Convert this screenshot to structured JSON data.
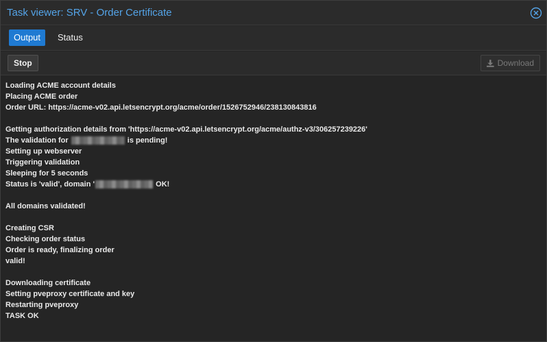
{
  "window": {
    "title": "Task viewer: SRV - Order Certificate",
    "accent_color": "#54a4e8",
    "close_icon": "close-circle-icon"
  },
  "tabs": [
    {
      "label": "Output",
      "active": true
    },
    {
      "label": "Status",
      "active": false
    }
  ],
  "toolbar": {
    "stop_label": "Stop",
    "download_label": "Download",
    "download_enabled": false,
    "download_icon": "download-icon"
  },
  "log": {
    "lines": [
      "Loading ACME account details",
      "Placing ACME order",
      "Order URL: https://acme-v02.api.letsencrypt.org/acme/order/1526752946/238130843816",
      "",
      "Getting authorization details from 'https://acme-v02.api.letsencrypt.org/acme/authz-v3/306257239226'",
      "The validation for [redacted] is pending!",
      "Setting up webserver",
      "Triggering validation",
      "Sleeping for 5 seconds",
      "Status is 'valid', domain '[redacted]' OK!",
      "",
      "All domains validated!",
      "",
      "Creating CSR",
      "Checking order status",
      "Order is ready, finalizing order",
      "valid!",
      "",
      "Downloading certificate",
      "Setting pveproxy certificate and key",
      "Restarting pveproxy",
      "TASK OK"
    ],
    "line5_before": "The validation for ",
    "line5_after": " is pending!",
    "line9_before": "Status is 'valid', domain '",
    "line9_after": " OK!"
  }
}
